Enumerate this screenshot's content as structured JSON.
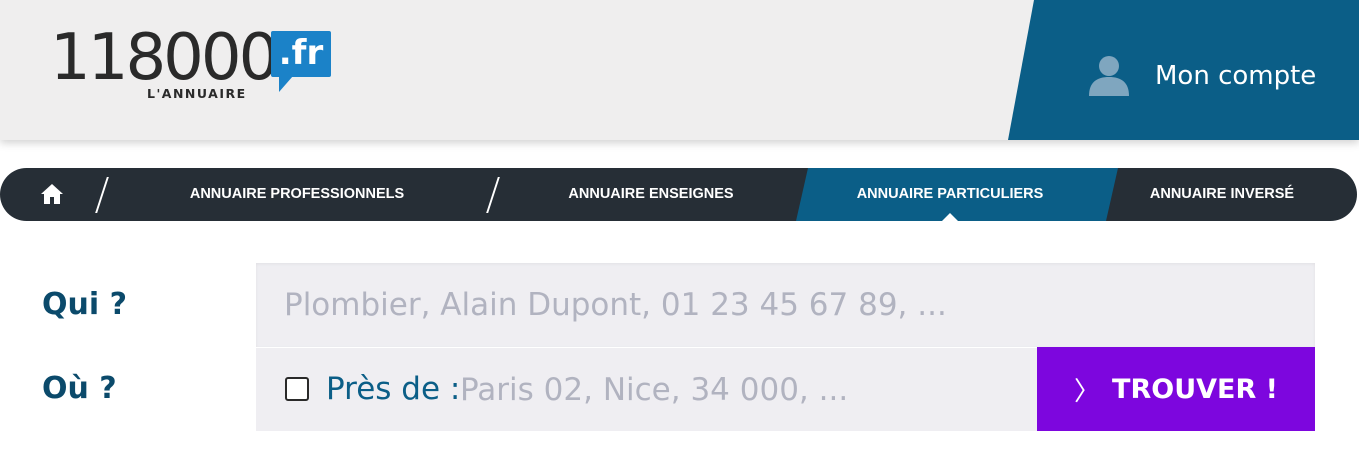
{
  "brand": {
    "logo_digits": "118000",
    "logo_tld": ".fr",
    "logo_tagline": "L'ANNUAIRE",
    "accent_blue": "#1b82c8"
  },
  "header": {
    "account_label": "Mon compte",
    "account_icon": "user-icon",
    "account_bg": "#0b5e87"
  },
  "nav": {
    "home_icon": "home-icon",
    "items": [
      {
        "label": "ANNUAIRE PROFESSIONNELS",
        "active": false
      },
      {
        "label": "ANNUAIRE ENSEIGNES",
        "active": false
      },
      {
        "label": "ANNUAIRE PARTICULIERS",
        "active": true
      },
      {
        "label": "ANNUAIRE INVERSÉ",
        "active": false
      }
    ],
    "bg": "#262e36",
    "active_bg": "#0b5e87"
  },
  "search": {
    "who_label": "Qui ?",
    "who_placeholder": "Plombier, Alain Dupont, 01 23 45 67 89, ...",
    "where_label": "Où ?",
    "near_label": "Près de :",
    "near_checked": false,
    "where_placeholder": "Paris 02, Nice, 34 000, ...",
    "submit_label": "TROUVER !",
    "submit_icon": "chevron-right-icon",
    "submit_color": "#7d06de"
  }
}
